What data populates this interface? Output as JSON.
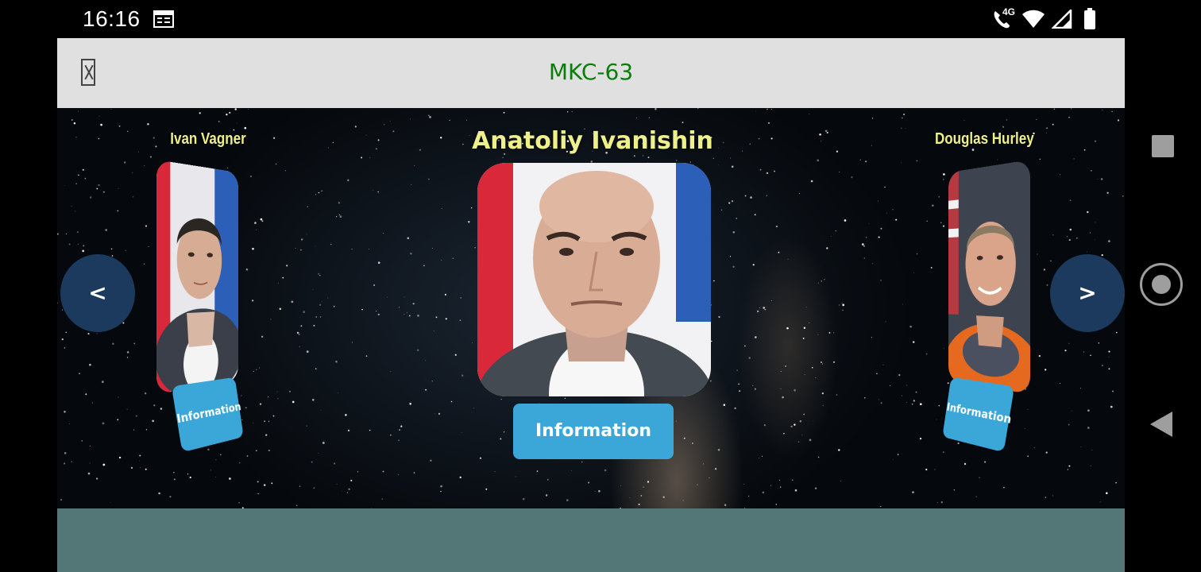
{
  "status_bar": {
    "time": "16:16",
    "network_label": "4G",
    "icons": [
      "calendar-icon",
      "wifi-calling-icon",
      "wifi-icon",
      "signal-icon",
      "battery-icon"
    ]
  },
  "app_bar": {
    "title": "MKC-63",
    "title_color": "#0a7d0a",
    "menu_icon": "missing-glyph-icon"
  },
  "carousel": {
    "prev_label": "<",
    "next_label": ">",
    "astronauts": [
      {
        "name": "Ivan Vagner",
        "button_label": "Information",
        "position": "left"
      },
      {
        "name": "Anatoliy  Ivanishin",
        "button_label": "Information",
        "position": "center"
      },
      {
        "name": "Douglas Hurley",
        "button_label": "Information",
        "position": "right"
      }
    ]
  },
  "colors": {
    "button": "#3aa7d8",
    "nav_button": "#1c3a5e",
    "name_text": "#eef08a",
    "bottom_panel": "#537676"
  },
  "system_nav": [
    "recents-icon",
    "home-icon",
    "back-icon"
  ]
}
